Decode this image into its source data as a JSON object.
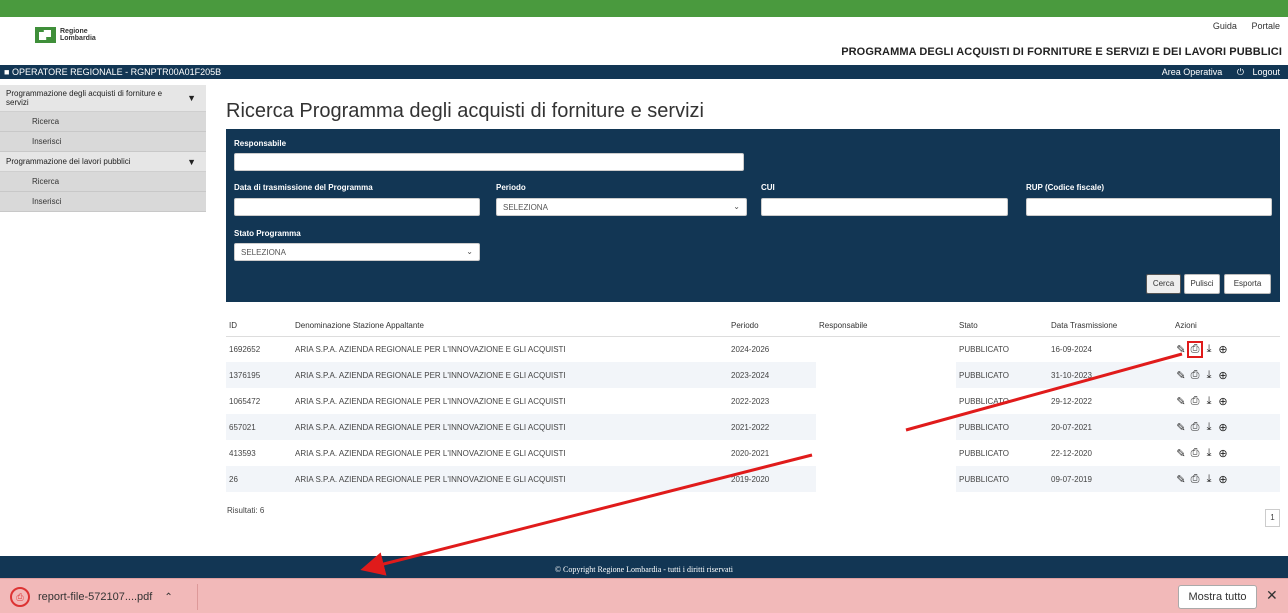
{
  "header": {
    "logo_text_1": "Regione",
    "logo_text_2": "Lombardia",
    "links": [
      "Guida",
      "Portale"
    ],
    "program_title": "PROGRAMMA DEGLI ACQUISTI DI FORNITURE E SERVIZI E DEI LAVORI PUBBLICI"
  },
  "userbar": {
    "user": "OPERATORE REGIONALE - RGNPTR00A01F205B",
    "area": "Area Operativa",
    "logout": "Logout"
  },
  "sidebar": {
    "sections": [
      {
        "label": "Programmazione degli acquisti di forniture e servizi",
        "items": [
          "Ricerca",
          "Inserisci"
        ]
      },
      {
        "label": "Programmazione dei lavori pubblici",
        "items": [
          "Ricerca",
          "Inserisci"
        ]
      }
    ]
  },
  "main": {
    "title": "Ricerca Programma degli acquisti di forniture e servizi"
  },
  "search": {
    "responsabile_label": "Responsabile",
    "data_label": "Data di trasmissione del Programma",
    "periodo_label": "Periodo",
    "periodo_value": "SELEZIONA",
    "cui_label": "CUI",
    "rup_label": "RUP (Codice fiscale)",
    "stato_label": "Stato Programma",
    "stato_value": "SELEZIONA",
    "cerca": "Cerca",
    "pulisci": "Pulisci",
    "esporta": "Esporta"
  },
  "table": {
    "headers": [
      "ID",
      "Denominazione Stazione Appaltante",
      "Periodo",
      "Responsabile",
      "Stato",
      "Data Trasmissione",
      "Azioni"
    ],
    "rows": [
      {
        "id": "1692652",
        "name": "ARIA S.P.A. AZIENDA REGIONALE PER L'INNOVAZIONE E GLI ACQUISTI",
        "periodo": "2024-2026",
        "responsabile": "",
        "stato": "PUBBLICATO",
        "data": "16-09-2024"
      },
      {
        "id": "1376195",
        "name": "ARIA S.P.A. AZIENDA REGIONALE PER L'INNOVAZIONE E GLI ACQUISTI",
        "periodo": "2023-2024",
        "responsabile": "",
        "stato": "PUBBLICATO",
        "data": "31-10-2023"
      },
      {
        "id": "1065472",
        "name": "ARIA S.P.A. AZIENDA REGIONALE PER L'INNOVAZIONE E GLI ACQUISTI",
        "periodo": "2022-2023",
        "responsabile": "",
        "stato": "PUBBLICATO",
        "data": "29-12-2022"
      },
      {
        "id": "657021",
        "name": "ARIA S.P.A. AZIENDA REGIONALE PER L'INNOVAZIONE E GLI ACQUISTI",
        "periodo": "2021-2022",
        "responsabile": "",
        "stato": "PUBBLICATO",
        "data": "20-07-2021"
      },
      {
        "id": "413593",
        "name": "ARIA S.P.A. AZIENDA REGIONALE PER L'INNOVAZIONE E GLI ACQUISTI",
        "periodo": "2020-2021",
        "responsabile": "",
        "stato": "PUBBLICATO",
        "data": "22-12-2020"
      },
      {
        "id": "26",
        "name": "ARIA S.P.A. AZIENDA REGIONALE PER L'INNOVAZIONE E GLI ACQUISTI",
        "periodo": "2019-2020",
        "responsabile": "",
        "stato": "PUBBLICATO",
        "data": "09-07-2019"
      }
    ],
    "action_icons": [
      "pencil-icon",
      "print-icon",
      "download-icon",
      "plus-circle-icon"
    ]
  },
  "results_label": "Risultati: 6",
  "pager_current": "1",
  "footer": "© Copyright Regione Lombardia - tutti i diritti riservati",
  "download_bar": {
    "file_name": "report-file-572107....pdf",
    "show_all": "Mostra tutto"
  },
  "colors": {
    "green_bar": "#4a9a3e",
    "navy": "#123654",
    "annotation_red": "#e01b1b",
    "download_bar_bg": "#f2b9b9"
  }
}
